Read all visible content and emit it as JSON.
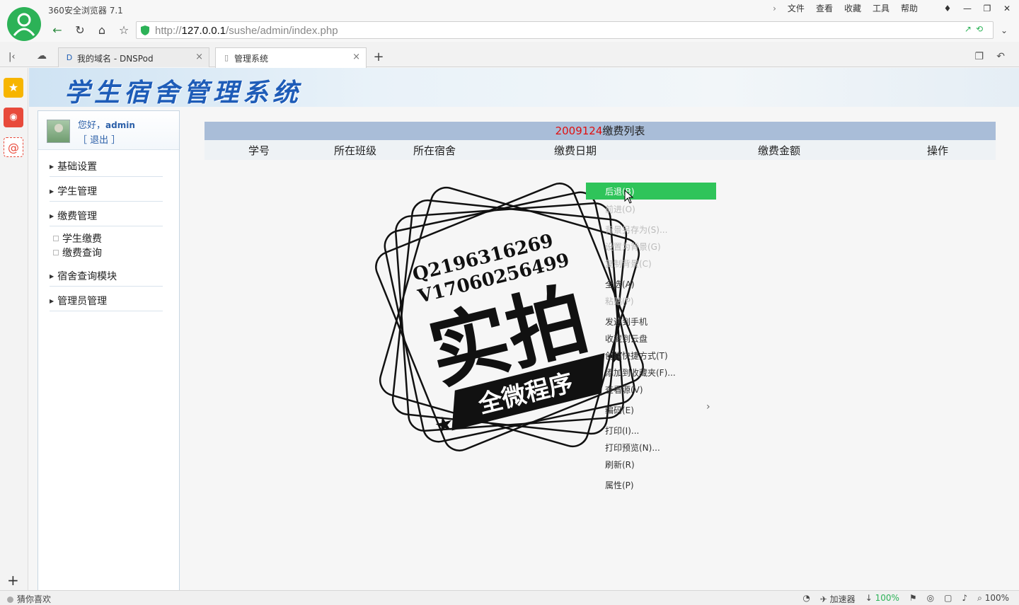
{
  "browser": {
    "app_title": "360安全浏览器 7.1",
    "menu": [
      "文件",
      "查看",
      "收藏",
      "工具",
      "帮助"
    ],
    "url_prefix": "http://",
    "url_host": "127.0.0.1",
    "url_path": "/sushe/admin/index.php",
    "tabs": [
      {
        "label": "我的域名 - DNSPod",
        "close": "×"
      },
      {
        "label": "管理系统",
        "close": "×"
      }
    ],
    "new_tab": "+",
    "status_left": "猜你喜欢",
    "status_accel": "加速器",
    "status_speed": "100%",
    "status_zoom": "100%"
  },
  "page": {
    "banner_title": "学生宿舍管理系统",
    "user": {
      "greeting": "您好，",
      "name": "admin",
      "logout": "［ 退出 ］"
    },
    "menu": [
      {
        "label": "基础设置"
      },
      {
        "label": "学生管理"
      },
      {
        "label": "缴费管理"
      },
      {
        "label": "宿舍查询模块"
      },
      {
        "label": "管理员管理"
      }
    ],
    "submenu": [
      "学生缴费",
      "缴费查询"
    ],
    "list": {
      "student_id": "2009124",
      "title": "缴费列表",
      "columns": [
        "学号",
        "所在班级",
        "所在宿舍",
        "缴费日期",
        "缴费金额",
        "操作"
      ]
    }
  },
  "context_menu": {
    "items": [
      "后退(B)",
      "前进(O)",
      "背景另存为(S)...",
      "设置为背景(G)",
      "复制背景(C)",
      "全选(A)",
      "粘贴(P)",
      "发送到手机",
      "收藏到云盘",
      "创建快捷方式(T)",
      "添加到收藏夹(F)...",
      "查看源(V)",
      "编码(E)",
      "打印(I)...",
      "打印预览(N)...",
      "刷新(R)",
      "属性(P)"
    ]
  },
  "watermark": {
    "line1": "Q2196316269",
    "line2": "V17060256499",
    "big": "实拍",
    "banner": "全微程序"
  }
}
